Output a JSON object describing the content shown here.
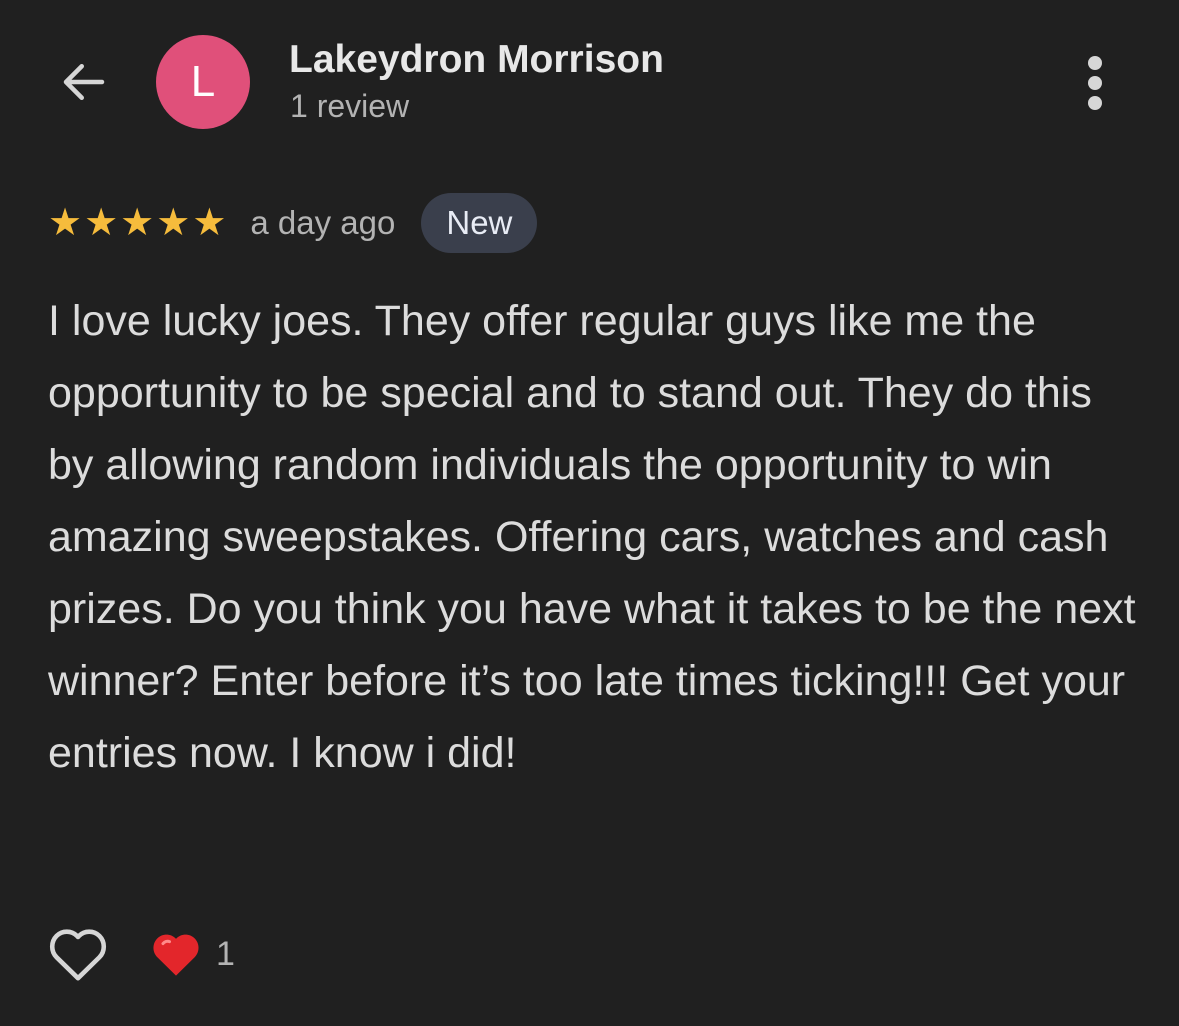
{
  "colors": {
    "background": "#202020",
    "avatar_bg": "#e0507a",
    "star": "#f6bc3c",
    "badge_bg": "#3a3f4c",
    "heart": "#e3262b"
  },
  "header": {
    "back_icon": "arrow-left-icon",
    "avatar_letter": "L",
    "name": "Lakeydron Morrison",
    "review_count": "1 review",
    "more_icon": "more-vertical-icon"
  },
  "review": {
    "rating": 5,
    "max_rating": 5,
    "time": "a day ago",
    "badge": "New",
    "text": "I love lucky joes. They offer regular guys like me the opportunity to be special and to stand out. They do this by allowing random individuals the opportunity to win amazing sweepstakes. Offering cars, watches and cash prizes. Do you think you have what it takes to be the next winner? Enter before it’s too late times ticking!!! Get your entries now. I know i did!"
  },
  "actions": {
    "like_icon": "heart-outline-icon",
    "reaction_icon": "heart-filled-icon",
    "reaction_count": "1"
  }
}
